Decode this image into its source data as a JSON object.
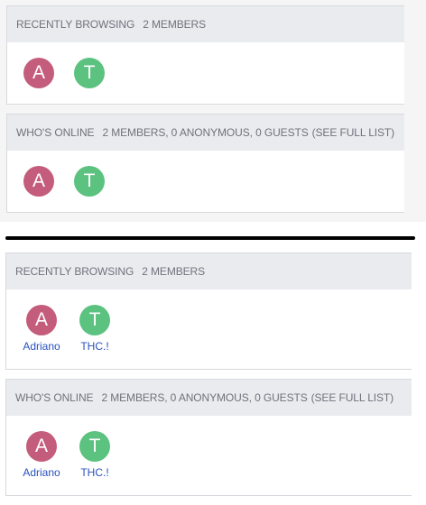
{
  "colors": {
    "avatar_a": "#c45c7c",
    "avatar_t": "#5cc27f",
    "username_link": "#2a52be",
    "header_bg": "#eaebef",
    "header_text": "#6e737b"
  },
  "top": {
    "recently_browsing": {
      "title": "RECENTLY BROWSING",
      "count": "2 MEMBERS",
      "members": [
        {
          "initial": "A"
        },
        {
          "initial": "T"
        }
      ]
    },
    "whos_online": {
      "title": "WHO'S ONLINE",
      "count": "2 MEMBERS, 0 ANONYMOUS, 0 GUESTS",
      "see_full_list": "(SEE FULL LIST)",
      "members": [
        {
          "initial": "A"
        },
        {
          "initial": "T"
        }
      ]
    }
  },
  "bottom": {
    "recently_browsing": {
      "title": "RECENTLY BROWSING",
      "count": "2 MEMBERS",
      "members": [
        {
          "initial": "A",
          "name": "Adriano"
        },
        {
          "initial": "T",
          "name": "THC.!"
        }
      ]
    },
    "whos_online": {
      "title": "WHO'S ONLINE",
      "count": "2 MEMBERS, 0 ANONYMOUS, 0 GUESTS",
      "see_full_list": "(SEE FULL LIST)",
      "members": [
        {
          "initial": "A",
          "name": "Adriano"
        },
        {
          "initial": "T",
          "name": "THC.!"
        }
      ]
    }
  }
}
